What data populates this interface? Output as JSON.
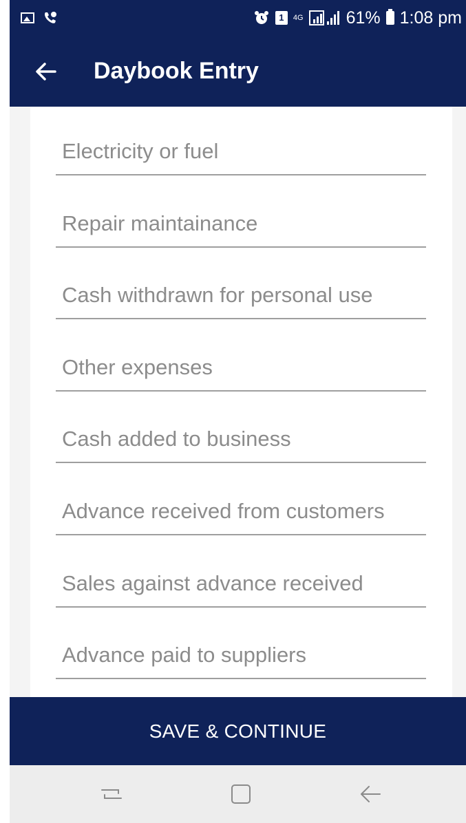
{
  "status_bar": {
    "lte": "4G",
    "battery": "61%",
    "time": "1:08 pm",
    "sim": "1"
  },
  "app_bar": {
    "title": "Daybook Entry"
  },
  "form": {
    "fields": [
      {
        "placeholder": "Electricity or fuel",
        "value": ""
      },
      {
        "placeholder": "Repair maintainance",
        "value": ""
      },
      {
        "placeholder": "Cash withdrawn for personal use",
        "value": ""
      },
      {
        "placeholder": "Other expenses",
        "value": ""
      },
      {
        "placeholder": "Cash added to business",
        "value": ""
      },
      {
        "placeholder": "Advance received from customers",
        "value": ""
      },
      {
        "placeholder": "Sales against advance received",
        "value": ""
      },
      {
        "placeholder": "Advance paid to suppliers",
        "value": ""
      }
    ]
  },
  "actions": {
    "save_label": "SAVE & CONTINUE"
  },
  "colors": {
    "primary": "#0f2259",
    "divider": "#9e9e9e",
    "placeholder": "#8c8c8c",
    "nav_background": "#ededed"
  }
}
